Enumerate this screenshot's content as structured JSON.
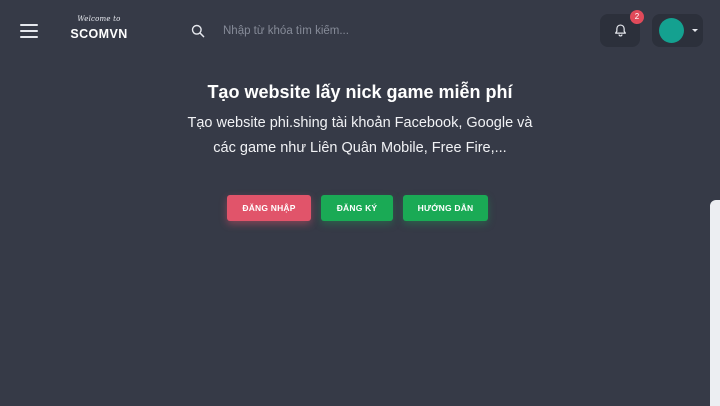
{
  "header": {
    "logo": {
      "tagline": "Welcome to",
      "brand": "SCOMVN"
    },
    "search": {
      "placeholder": "Nhập từ khóa tìm kiếm...",
      "value": ""
    },
    "notifications": {
      "count": "2",
      "icon": "bell-icon"
    },
    "user_menu": {
      "avatar_color": "#14a190",
      "icon": "caret-down-icon"
    }
  },
  "hero": {
    "title": "Tạo website lấy nick game miễn phí",
    "description": "Tạo website phi.shing tài khoản Facebook, Google và các game như Liên Quân Mobile, Free Fire,...",
    "buttons": {
      "login": "ĐĂNG NHẬP",
      "register": "ĐĂNG KÝ",
      "guide": "HƯỚNG DẪN"
    }
  },
  "colors": {
    "background": "#363a47",
    "login_button": "#e1546a",
    "register_button": "#1aaa55",
    "guide_button": "#1aaa55",
    "badge": "#e04a5a"
  }
}
